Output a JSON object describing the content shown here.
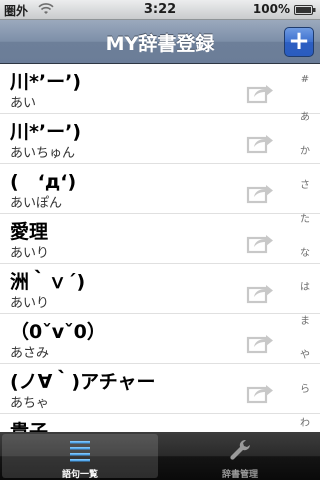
{
  "status": {
    "carrier": "圏外",
    "time": "3:22",
    "battery": "100%"
  },
  "navbar": {
    "title": "MY辞書登録",
    "add_label": "+"
  },
  "rows": [
    {
      "title": "川*’ー’)",
      "reading": "あい"
    },
    {
      "title": "川*’ー’)",
      "reading": "あいちゅん"
    },
    {
      "title": "(　‘д‘)",
      "reading": "あいぽん"
    },
    {
      "title": "愛理",
      "reading": "あいり"
    },
    {
      "title": "洲｀ｖ´)",
      "reading": "あいり"
    },
    {
      "title": "（0ˇvˇ0）",
      "reading": "あさみ"
    },
    {
      "title": "(ノ∀｀)アチャー",
      "reading": "あちゃ"
    },
    {
      "title": "貴子",
      "reading": ""
    }
  ],
  "index": [
    "#",
    "あ",
    "か",
    "さ",
    "た",
    "な",
    "は",
    "ま",
    "や",
    "ら",
    "わ"
  ],
  "tabs": [
    {
      "label": "語句一覧",
      "icon": "list-icon",
      "selected": true
    },
    {
      "label": "辞書管理",
      "icon": "wrench-icon",
      "selected": false
    }
  ]
}
